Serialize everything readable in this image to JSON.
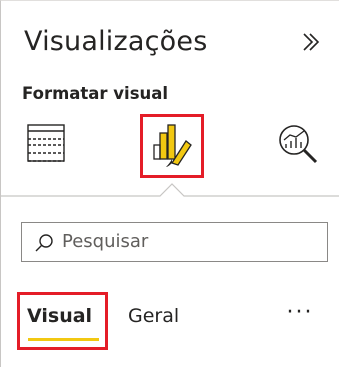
{
  "pane": {
    "title": "Visualizações",
    "collapse_icon": "double-chevron-right-icon",
    "subtitle": "Formatar visual"
  },
  "tabs_icons": [
    {
      "name": "fields-icon"
    },
    {
      "name": "format-paintbrush-icon",
      "selected": true
    },
    {
      "name": "analytics-magnifier-icon"
    }
  ],
  "search": {
    "placeholder": "Pesquisar",
    "icon": "search-icon"
  },
  "sub_tabs": {
    "visual_label": "Visual",
    "geral_label": "Geral",
    "more_label": "···"
  },
  "colors": {
    "highlight": "#e41d28",
    "accent": "#f2c811",
    "border": "#c8c6c4"
  }
}
